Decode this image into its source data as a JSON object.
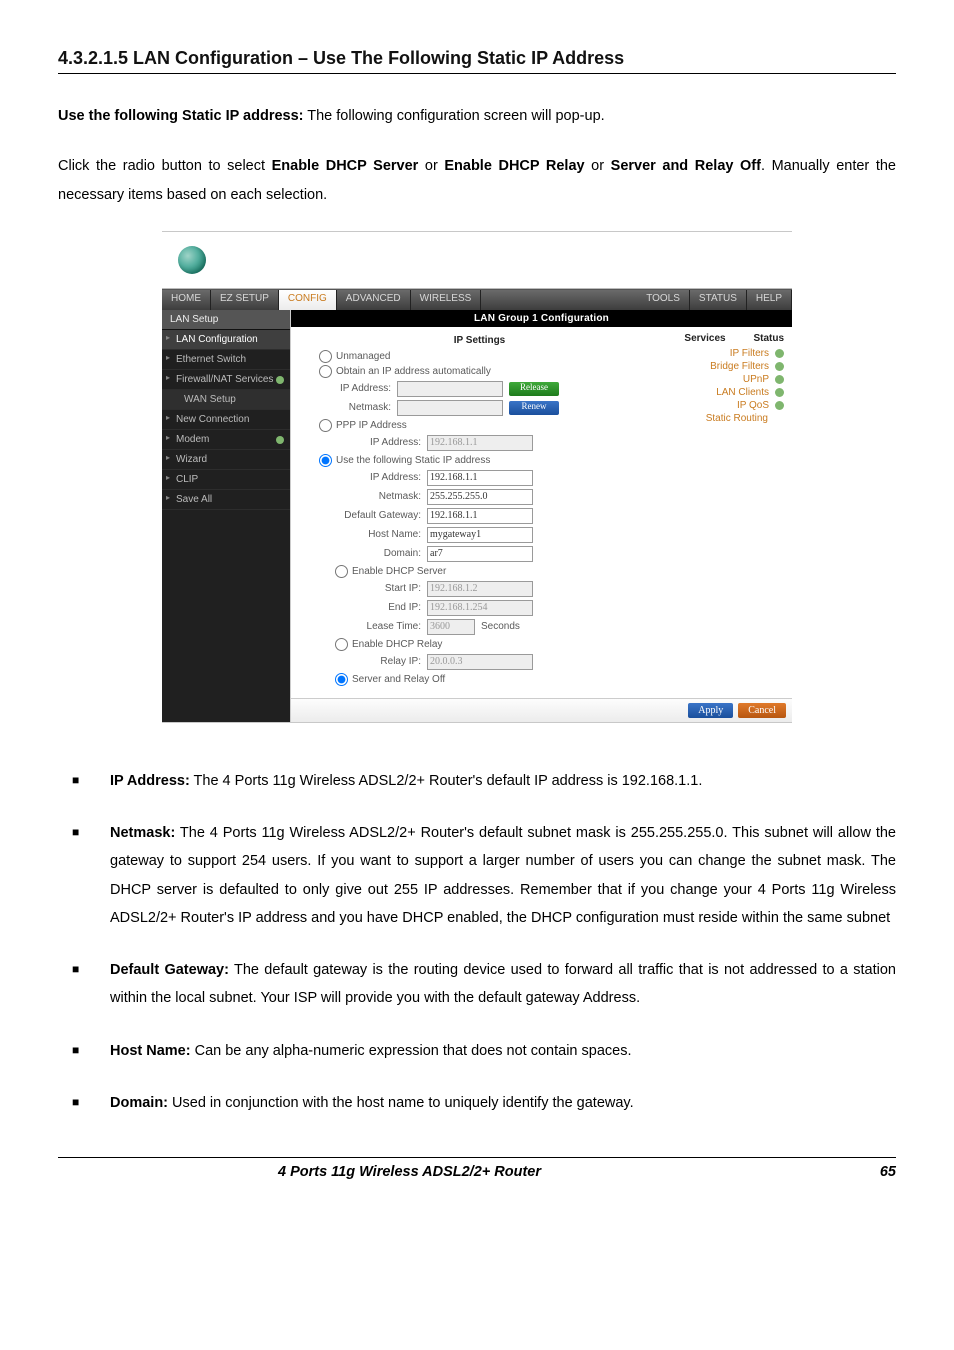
{
  "heading": "4.3.2.1.5 LAN Configuration – Use The Following Static IP Address",
  "intro_lead": "Use the following Static IP address:",
  "intro_rest": " The following configuration screen will pop-up.",
  "para2_a": "Click the radio button to select ",
  "para2_b1": "Enable DHCP Server",
  "para2_c": " or ",
  "para2_b2": "Enable DHCP Relay",
  "para2_d": " or ",
  "para2_b3": "Server and Relay Off",
  "para2_e": ". Manually enter the necessary items based on each selection.",
  "tabs": [
    "HOME",
    "EZ SETUP",
    "CONFIG",
    "ADVANCED",
    "WIRELESS",
    "TOOLS",
    "STATUS",
    "HELP"
  ],
  "active_tab": 2,
  "side": {
    "group_top": "LAN Setup",
    "items": [
      {
        "label": "LAN Configuration",
        "sel": true
      },
      {
        "label": "Ethernet Switch"
      },
      {
        "label": "Firewall/NAT Services",
        "tick": true
      },
      {
        "label": "WAN Setup",
        "sub": true
      },
      {
        "label": "New Connection"
      },
      {
        "label": "Modem",
        "tick": true
      },
      {
        "label": "Wizard"
      },
      {
        "label": "CLIP"
      },
      {
        "label": "Save All"
      }
    ]
  },
  "panel_title": "LAN Group 1 Configuration",
  "ip_settings_header": "IP Settings",
  "radios": {
    "unmanaged": "Unmanaged",
    "obtain": "Obtain an IP address automatically",
    "ppp": "PPP IP Address",
    "use_static": "Use the following Static IP address",
    "enable_dhcp_server": "Enable DHCP Server",
    "enable_dhcp_relay": "Enable DHCP Relay",
    "server_relay_off": "Server and Relay Off"
  },
  "labels": {
    "ip_address": "IP Address:",
    "netmask": "Netmask:",
    "default_gateway": "Default Gateway:",
    "host_name": "Host Name:",
    "domain": "Domain:",
    "start_ip": "Start IP:",
    "end_ip": "End IP:",
    "lease_time": "Lease Time:",
    "seconds": "Seconds",
    "relay_ip": "Relay IP:"
  },
  "values": {
    "ppp_ip": "192.168.1.1",
    "static_ip": "192.168.1.1",
    "static_nm": "255.255.255.0",
    "static_gw": "192.168.1.1",
    "host": "mygateway1",
    "domain": "ar7",
    "start_ip": "192.168.1.2",
    "end_ip": "192.168.1.254",
    "lease": "3600",
    "relay_ip": "20.0.0.3"
  },
  "buttons": {
    "release": "Release",
    "renew": "Renew",
    "apply": "Apply",
    "cancel": "Cancel"
  },
  "services_header": "Services",
  "status_header": "Status",
  "services": [
    "IP Filters",
    "Bridge Filters",
    "UPnP",
    "LAN Clients",
    "IP QoS"
  ],
  "services_static": "Static Routing",
  "bullets": {
    "ip_lbl": "IP Address:",
    "ip_txt": " The 4 Ports 11g Wireless ADSL2/2+ Router's default IP address is 192.168.1.1.",
    "nm_lbl": "Netmask:",
    "nm_txt": " The 4 Ports 11g Wireless ADSL2/2+ Router's default subnet mask is 255.255.255.0. This subnet will allow the gateway to support 254 users. If you want to support a larger number of users you can change the subnet mask. The DHCP server is defaulted to only give out 255 IP addresses. Remember that if you change your 4 Ports 11g Wireless ADSL2/2+ Router's IP address and you have DHCP enabled, the DHCP configuration must reside within the same subnet",
    "gw_lbl": "Default Gateway:",
    "gw_txt": " The default gateway is the routing device used to forward all traffic that is not addressed to a station within the local subnet. Your ISP will provide you with the default gateway Address.",
    "hn_lbl": "Host Name:",
    "hn_txt": " Can be any alpha-numeric expression that does not contain spaces.",
    "dm_lbl": "Domain:",
    "dm_txt": " Used in conjunction with the host name to uniquely identify the gateway."
  },
  "footer": {
    "title": "4 Ports 11g Wireless ADSL2/2+ Router",
    "page": "65"
  }
}
